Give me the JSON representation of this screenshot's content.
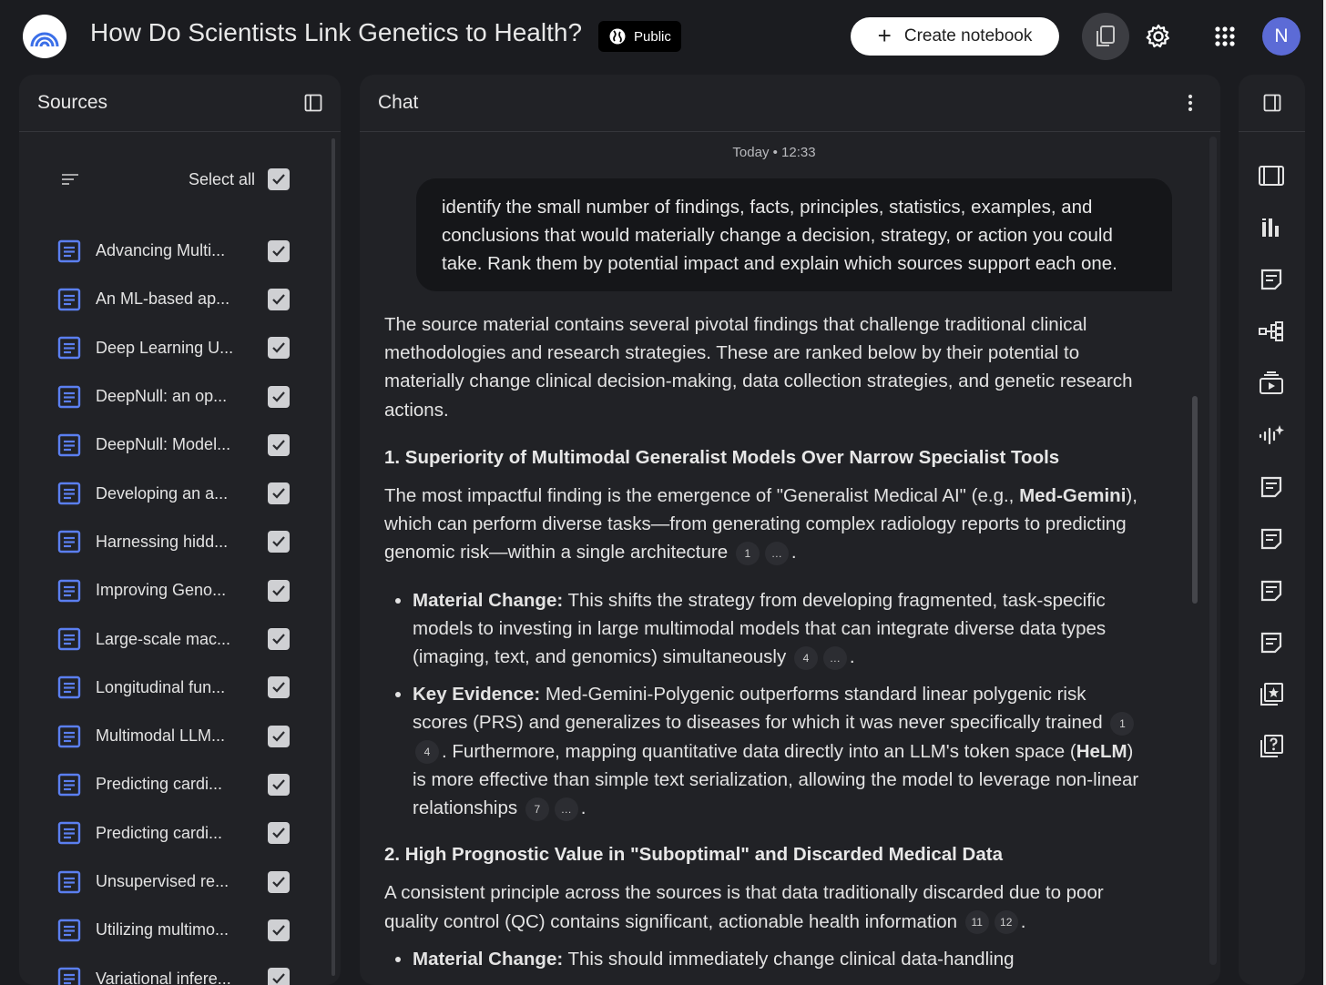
{
  "header": {
    "title": "How Do Scientists Link Genetics to Health?",
    "visibility": "Public",
    "create_label": "Create notebook",
    "create_plus": "+",
    "avatar_initial": "N"
  },
  "sources": {
    "title": "Sources",
    "select_all": "Select all",
    "items": [
      "Advancing Multi...",
      "An ML-based ap...",
      "Deep Learning U...",
      "DeepNull: an op...",
      "DeepNull: Model...",
      "Developing an a...",
      "Harnessing hidd...",
      "Improving Geno...",
      "Large-scale mac...",
      "Longitudinal fun...",
      "Multimodal LLM...",
      "Predicting cardi...",
      "Predicting cardi...",
      "Unsupervised re...",
      "Utilizing multimo...",
      "Variational infere..."
    ]
  },
  "chat": {
    "title": "Chat",
    "timestamp": "Today • 12:33",
    "user_message": "identify the small number of findings, facts, principles, statistics, examples, and conclusions that would materially change a decision, strategy, or action you could take. Rank them by potential impact and explain which sources support each one.",
    "intro": "The source material contains several pivotal findings that challenge traditional clinical methodologies and research strategies. These are ranked below by their potential to materially change clinical decision-making, data collection strategies, and genetic research actions.",
    "s1": {
      "heading": "1. Superiority of Multimodal Generalist Models Over Narrow Specialist Tools",
      "p_a": "The most impactful finding is the emergence of \"Generalist Medical AI\" (e.g., ",
      "p_bold": "Med-Gemini",
      "p_b": "), which can perform diverse tasks—from generating complex radiology reports to predicting genomic risk—within a single architecture",
      "p_c1": "1",
      "p_c2": "…",
      "b1_label": "Material Change:",
      "b1_text": " This shifts the strategy from developing fragmented, task-specific models to investing in large multimodal models that can integrate diverse data types (imaging, text, and genomics) simultaneously",
      "b1_c1": "4",
      "b1_c2": "…",
      "b2_label": "Key Evidence:",
      "b2_text": " Med-Gemini-Polygenic outperforms standard linear polygenic risk scores (PRS) and generalizes to diseases for which it was never specifically trained",
      "b2_c1": "1",
      "b2_c2": "4",
      "b2_text2": ". Furthermore, mapping quantitative data directly into an LLM's token space (",
      "b2_bold": "HeLM",
      "b2_text3": ") is more effective than simple text serialization, allowing the model to leverage non-linear relationships",
      "b2_c3": "7",
      "b2_c4": "…"
    },
    "s2": {
      "heading": "2. High Prognostic Value in \"Suboptimal\" and Discarded Medical Data",
      "p": "A consistent principle across the sources is that data traditionally discarded due to poor quality control (QC) contains significant, actionable health information",
      "p_c1": "11",
      "p_c2": "12",
      "b1_label": "Material Change:",
      "b1_text": " This should immediately change clinical data-handling"
    }
  },
  "colors": {
    "background": "#1b1c20",
    "panel": "#212226",
    "accent_doc": "#5b7ff0",
    "avatar": "#5c6bd6"
  }
}
